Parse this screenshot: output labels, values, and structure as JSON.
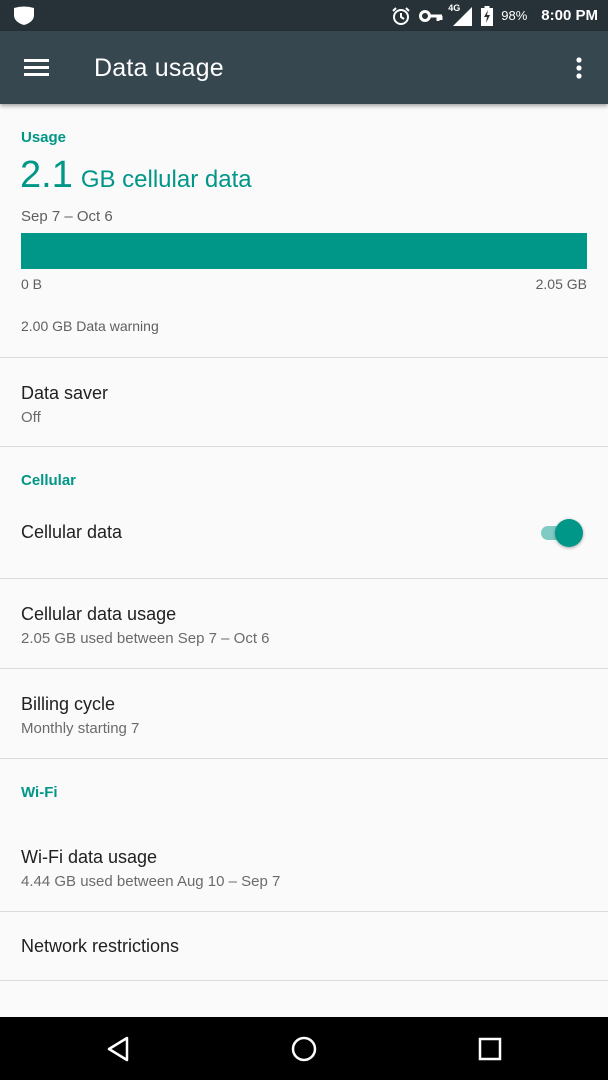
{
  "status_bar": {
    "network": "4G",
    "battery": "98%",
    "time": "8:00 PM"
  },
  "app_bar": {
    "title": "Data usage"
  },
  "usage": {
    "label": "Usage",
    "amount": "2.1",
    "unit": "GB cellular data",
    "range": "Sep 7 – Oct 6",
    "bar_min": "0 B",
    "bar_max": "2.05 GB",
    "fill_fraction": 1.0,
    "warning": "2.00 GB Data warning"
  },
  "data_saver": {
    "title": "Data saver",
    "summary": "Off"
  },
  "cellular": {
    "category": "Cellular",
    "cellular_data_title": "Cellular data",
    "cellular_data_enabled": true,
    "usage_title": "Cellular data usage",
    "usage_summary": "2.05 GB used between Sep 7 – Oct 6",
    "billing_title": "Billing cycle",
    "billing_summary": "Monthly starting 7"
  },
  "wifi": {
    "category": "Wi-Fi",
    "usage_title": "Wi-Fi data usage",
    "usage_summary": "4.44 GB used between Aug 10 – Sep 7"
  },
  "network_restrictions": {
    "title": "Network restrictions"
  },
  "colors": {
    "accent": "#009688",
    "app_bar": "#37474f",
    "status_bar": "#263238"
  }
}
